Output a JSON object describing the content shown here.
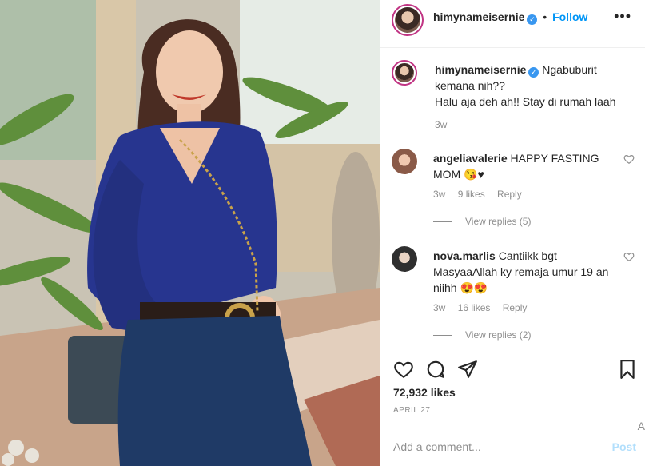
{
  "post": {
    "username": "himynameisernie",
    "follow_label": "Follow",
    "more_label": "•••",
    "verified_mark": "✓"
  },
  "caption": {
    "username": "himynameisernie",
    "text": "Ngabuburit kemana nih??",
    "text2": "Halu aja deh ah!! Stay di rumah laah",
    "time": "3w"
  },
  "comments": [
    {
      "username": "angeliavalerie",
      "text": "HAPPY FASTING MOM 😘♥",
      "time": "3w",
      "likes": "9 likes",
      "reply_label": "Reply",
      "view_replies": "View replies (5)"
    },
    {
      "username": "nova.marlis",
      "text": "Cantiikk bgt MasyaaAllah ky remaja umur 19 an niihh 😍😍",
      "time": "3w",
      "likes": "16 likes",
      "reply_label": "Reply",
      "view_replies": "View replies (2)"
    }
  ],
  "icons": {
    "like": "heart-icon",
    "comment": "comment-icon",
    "share": "share-icon",
    "save": "bookmark-icon"
  },
  "likes_count": "72,932 likes",
  "date": "APRIL 27",
  "add_comment": {
    "placeholder": "Add a comment...",
    "post_label": "Post"
  },
  "edge_letter": "A",
  "colors": {
    "follow": "#0095f6",
    "verified": "#3897f0",
    "post_disabled": "#b2dffc",
    "muted": "#8e8e8e"
  }
}
